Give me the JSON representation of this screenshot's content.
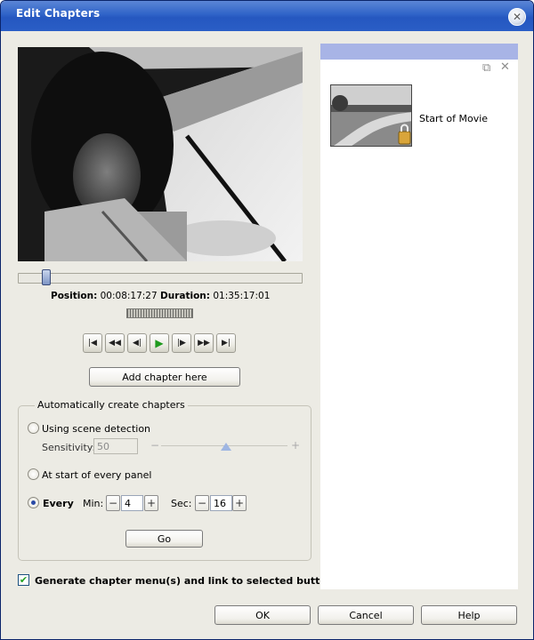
{
  "window": {
    "title": "Edit Chapters",
    "close_glyph": "✕"
  },
  "player": {
    "position_label": "Position:",
    "position_value": "00:08:17:27",
    "duration_label": "Duration:",
    "duration_value": "01:35:17:01",
    "transport": [
      {
        "name": "go-to-start-button",
        "glyph": "|◀"
      },
      {
        "name": "rewind-button",
        "glyph": "◀◀"
      },
      {
        "name": "step-back-button",
        "glyph": "◀|"
      },
      {
        "name": "play-button",
        "glyph": "▶"
      },
      {
        "name": "step-forward-button",
        "glyph": "|▶"
      },
      {
        "name": "fast-forward-button",
        "glyph": "▶▶"
      },
      {
        "name": "go-to-end-button",
        "glyph": "▶|"
      }
    ],
    "add_chapter_label": "Add chapter here"
  },
  "auto": {
    "legend": "Automatically create chapters",
    "scene_label": "Using scene detection",
    "sensitivity_label": "Sensitivity:",
    "sensitivity_value": "50",
    "panel_label": "At start of every panel",
    "every_label": "Every",
    "min_label": "Min:",
    "min_value": "4",
    "sec_label": "Sec:",
    "sec_value": "16",
    "minus": "−",
    "plus": "+",
    "slider_minus": "−",
    "slider_plus": "+",
    "go_label": "Go"
  },
  "generate_label": "Generate chapter menu(s) and link to selected button",
  "chapters": {
    "items": [
      {
        "label": "Start of Movie"
      }
    ],
    "copy_glyph": "⧉",
    "delete_glyph": "✕"
  },
  "footer": {
    "ok": "OK",
    "cancel": "Cancel",
    "help": "Help"
  }
}
